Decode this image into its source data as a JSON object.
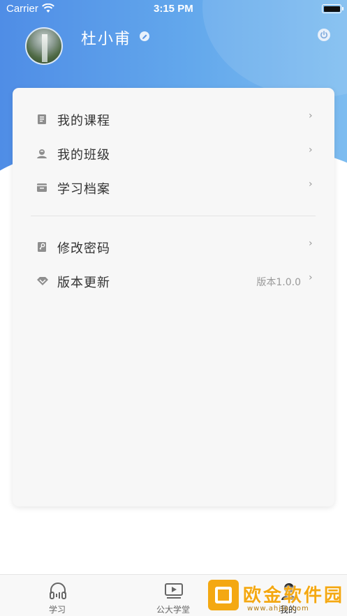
{
  "status_bar": {
    "carrier": "Carrier",
    "time": "3:15 PM"
  },
  "profile": {
    "name": "杜小甫"
  },
  "menu": {
    "items": [
      {
        "label": "我的课程",
        "icon": "book-icon"
      },
      {
        "label": "我的班级",
        "icon": "class-user-icon"
      },
      {
        "label": "学习档案",
        "icon": "archive-icon"
      },
      {
        "label": "修改密码",
        "icon": "key-icon"
      },
      {
        "label": "版本更新",
        "icon": "diamond-icon",
        "value": "版本1.0.0"
      }
    ]
  },
  "tabbar": {
    "tabs": [
      {
        "label": "学习",
        "icon": "headphones-icon"
      },
      {
        "label": "公大学堂",
        "icon": "video-icon"
      },
      {
        "label": "我的",
        "icon": "user-icon",
        "active": true
      }
    ]
  },
  "watermark": {
    "text": "欧金软件园",
    "url": "www.ahjin.com"
  },
  "colors": {
    "header_gradient_start": "#4f8de6",
    "header_gradient_end": "#7dbcf0",
    "card_background": "#f7f7f7",
    "watermark": "#f4a812"
  }
}
